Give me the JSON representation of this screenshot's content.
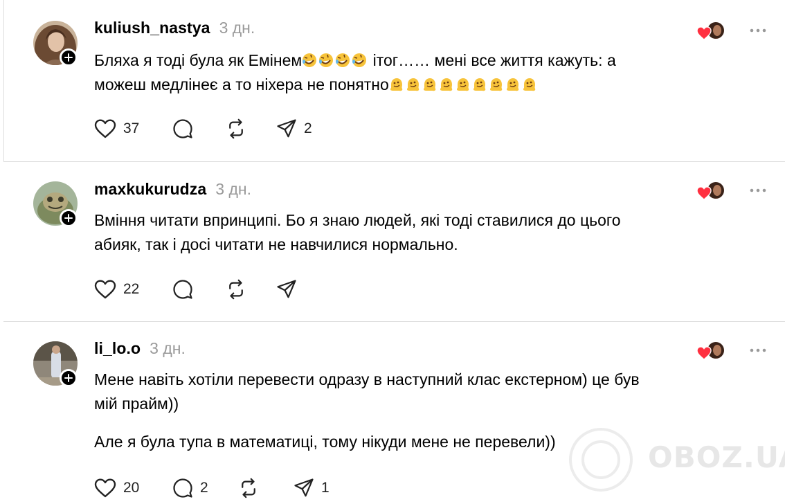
{
  "comments": [
    {
      "username": "kuliush_nastya",
      "time": "3 дн.",
      "text_lines": [
        "Бляха я тоді була як Емінем🤣🤣🤣🤣 ітог…… мені все життя кажуть: а",
        "можеш медлінеє а то ніхера не понятно🫠🫠🫠🫠🫠🫠🫠🫠🫠"
      ],
      "line1_prefix": "Бляха я тоді була як Емінем",
      "line1_suffix": " ітог…… мені все життя кажуть: а",
      "line2_prefix": "можеш медлінеє а то ніхера не понятно",
      "likes": "37",
      "replies": "",
      "reposts": "",
      "shares": "2"
    },
    {
      "username": "maxkukurudza",
      "time": "3 дн.",
      "text_lines": [
        "Вміння читати впринципі. Бо я знаю людей, які тоді ставилися до цього",
        "абияк, так і досі читати не навчилися нормально."
      ],
      "likes": "22",
      "replies": "",
      "reposts": "",
      "shares": ""
    },
    {
      "username": "li_lo.o",
      "time": "3 дн.",
      "text_lines": [
        "Мене навіть хотіли перевести одразу в наступний клас екстерном) це був",
        "мій прайм))",
        "Але я була тупа в математиці, тому нікуди мене не перевели))"
      ],
      "likes": "20",
      "replies": "2",
      "reposts": "",
      "shares": "1"
    }
  ],
  "icons": {
    "like": "heart-outline-icon",
    "reply": "speech-bubble-icon",
    "repost": "repost-arrows-icon",
    "share": "paper-plane-icon",
    "liked_by_author": "red-heart-icon",
    "more": "more-dots-icon",
    "follow": "plus-icon"
  },
  "colors": {
    "heart": "#ff3040",
    "muted": "#9a9a9a",
    "divider": "#dcdcdc"
  },
  "watermark": "OBOZ.UA"
}
